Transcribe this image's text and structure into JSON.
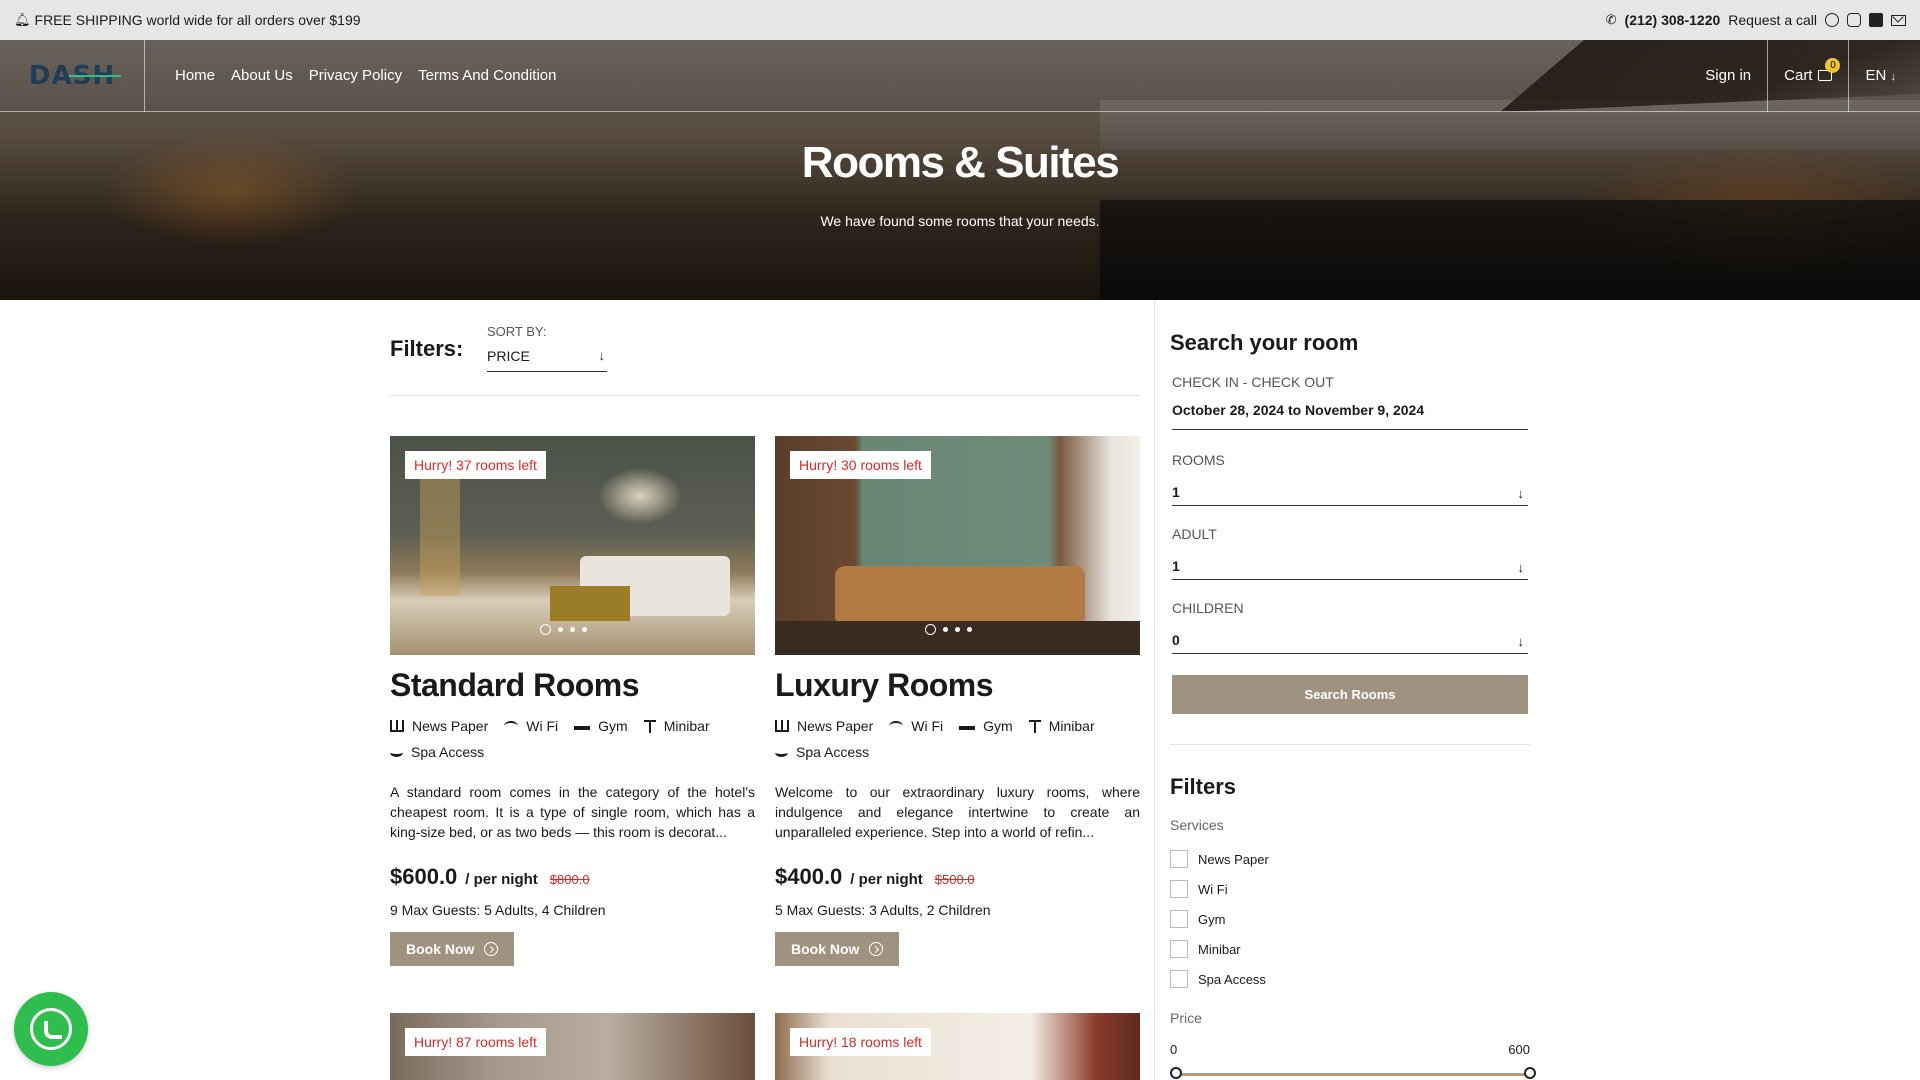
{
  "topbar": {
    "shipping": "FREE SHIPPING world wide for all orders over $199",
    "phone": "(212) 308-1220",
    "request_call": "Request a call"
  },
  "nav": {
    "links": [
      "Home",
      "About Us",
      "Privacy Policy",
      "Terms And Condition"
    ],
    "signin": "Sign in",
    "cart": "Cart",
    "cart_count": "0",
    "lang": "EN"
  },
  "hero": {
    "title": "Rooms & Suites",
    "subtitle": "We have found some rooms that your needs."
  },
  "filters": {
    "label": "Filters:",
    "sort_label": "SORT BY:",
    "sort_value": "PRICE"
  },
  "rooms": [
    {
      "badge": "Hurry! 37 rooms left",
      "title": "Standard Rooms",
      "amenities": [
        "News Paper",
        "Wi Fi",
        "Gym",
        "Minibar",
        "Spa Access"
      ],
      "desc": "A standard room comes in the category of the hotel's cheapest room. It is a type of single room, which has a king-size bed, or as two beds — this room is decorat...",
      "price": "$600.0",
      "per": "/ per night",
      "old_price": "$800.0",
      "guests": "9 Max Guests: 5 Adults, 4 Children",
      "button": "Book Now"
    },
    {
      "badge": "Hurry! 30 rooms left",
      "title": "Luxury Rooms",
      "amenities": [
        "News Paper",
        "Wi Fi",
        "Gym",
        "Minibar",
        "Spa Access"
      ],
      "desc": "Welcome to our extraordinary luxury rooms, where indulgence and elegance intertwine to create an unparalleled experience. Step into a world of refin...",
      "price": "$400.0",
      "per": "/ per night",
      "old_price": "$500.0",
      "guests": "5 Max Guests: 3 Adults, 2 Children",
      "button": "Book Now"
    },
    {
      "badge": "Hurry! 87 rooms left"
    },
    {
      "badge": "Hurry! 18 rooms left"
    }
  ],
  "sidebar": {
    "title": "Search your room",
    "checkin_label": "CHECK IN - CHECK OUT",
    "checkin_value": "October 28, 2024 to November 9, 2024",
    "rooms_label": "ROOMS",
    "rooms_value": "1",
    "adult_label": "ADULT",
    "adult_value": "1",
    "children_label": "CHILDREN",
    "children_value": "0",
    "search_button": "Search Rooms",
    "filters_title": "Filters",
    "services_label": "Services",
    "services": [
      "News Paper",
      "Wi Fi",
      "Gym",
      "Minibar",
      "Spa Access"
    ],
    "price_label": "Price",
    "price_min": "0",
    "price_max": "600"
  },
  "colors": {
    "accent": "#a09281",
    "badge_red": "#d62b2b",
    "whatsapp": "#2fbe4e"
  }
}
